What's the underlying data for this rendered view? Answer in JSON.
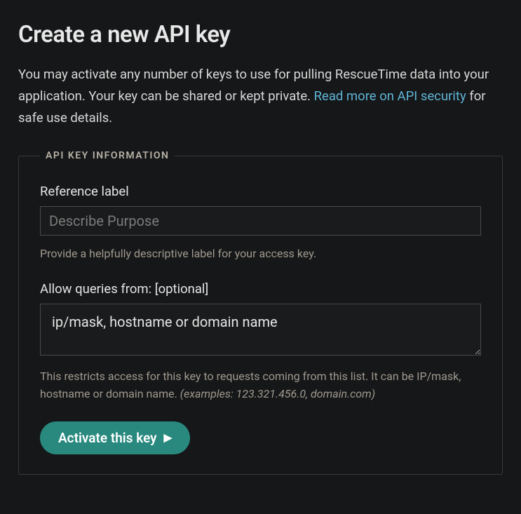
{
  "header": {
    "title": "Create a new API key",
    "intro_before_link": "You may activate any number of keys to use for pulling RescueTime data into your application. Your key can be shared or kept private. ",
    "link_text": "Read more on API security",
    "intro_after_link": " for safe use details."
  },
  "fieldset": {
    "legend": "API KEY INFORMATION",
    "reference_label": {
      "label": "Reference label",
      "placeholder": "Describe Purpose",
      "value": "",
      "help": "Provide a helpfully descriptive label for your access key."
    },
    "allow_queries": {
      "label": "Allow queries from: [optional]",
      "value": "ip/mask, hostname or domain name",
      "help_main": "This restricts access for this key to requests coming from this list. It can be IP/mask, hostname or domain name. ",
      "help_examples": "(examples: 123.321.456.0, domain.com)"
    },
    "button_label": "Activate this key"
  }
}
